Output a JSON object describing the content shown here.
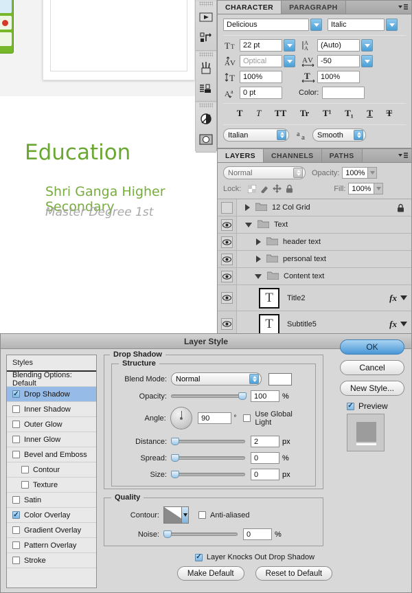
{
  "canvas": {
    "title": "Education",
    "subtitle": "Shri Ganga Higher Secondary",
    "subtitle2": "Master Degree 1st",
    "title_color": "#6aa832",
    "subtitle_color": "#77ac3f",
    "subtitle2_color": "#a8a8a8"
  },
  "icon_dock": {
    "items": [
      {
        "name": "play-icon"
      },
      {
        "name": "actions-icon"
      },
      {
        "name": "brushes-icon"
      },
      {
        "name": "clone-source-icon"
      },
      {
        "name": "adjustments-icon"
      },
      {
        "name": "masks-icon"
      }
    ]
  },
  "character_panel": {
    "tabs": [
      {
        "label": "CHARACTER",
        "active": true
      },
      {
        "label": "PARAGRAPH",
        "active": false
      }
    ],
    "font_family": "Delicious",
    "font_style": "Italic",
    "font_size": "22 pt",
    "leading": "(Auto)",
    "kerning": "Optical",
    "tracking": "-50",
    "vertical_scale": "100%",
    "horizontal_scale": "100%",
    "baseline_shift": "0 pt",
    "color_label": "Color:",
    "color_value": "#ffffff",
    "language": "Italian",
    "anti_alias": "Smooth",
    "text_styles": [
      "T",
      "T",
      "TT",
      "Tr",
      "T¹",
      "T₁",
      "T",
      "T"
    ]
  },
  "layers_panel": {
    "tabs": [
      {
        "label": "LAYERS",
        "active": true
      },
      {
        "label": "CHANNELS",
        "active": false
      },
      {
        "label": "PATHS",
        "active": false
      }
    ],
    "blend_mode": "Normal",
    "opacity_label": "Opacity:",
    "opacity_value": "100%",
    "lock_label": "Lock:",
    "fill_label": "Fill:",
    "fill_value": "100%",
    "layers": [
      {
        "name": "12 Col Grid",
        "visible": false,
        "type": "group",
        "expanded": false,
        "indent": 0,
        "locked": true,
        "fx": false
      },
      {
        "name": "Text",
        "visible": true,
        "type": "group",
        "expanded": true,
        "indent": 0,
        "locked": false,
        "fx": false
      },
      {
        "name": "header text",
        "visible": true,
        "type": "group",
        "expanded": false,
        "indent": 1,
        "locked": false,
        "fx": false
      },
      {
        "name": "personal text",
        "visible": true,
        "type": "group",
        "expanded": false,
        "indent": 1,
        "locked": false,
        "fx": false
      },
      {
        "name": "Content text",
        "visible": true,
        "type": "group",
        "expanded": true,
        "indent": 1,
        "locked": false,
        "fx": false
      },
      {
        "name": "Title2",
        "visible": true,
        "type": "text",
        "indent": 2,
        "locked": false,
        "fx": true
      },
      {
        "name": "Subtitle5",
        "visible": true,
        "type": "text",
        "indent": 2,
        "locked": false,
        "fx": true
      }
    ]
  },
  "layer_style": {
    "title": "Layer Style",
    "styles_header": "Styles",
    "styles": [
      {
        "label": "Blending Options: Default",
        "checkbox": false,
        "checked": false,
        "selected": false,
        "sub": false
      },
      {
        "label": "Drop Shadow",
        "checkbox": true,
        "checked": true,
        "selected": true,
        "sub": false
      },
      {
        "label": "Inner Shadow",
        "checkbox": true,
        "checked": false,
        "selected": false,
        "sub": false
      },
      {
        "label": "Outer Glow",
        "checkbox": true,
        "checked": false,
        "selected": false,
        "sub": false
      },
      {
        "label": "Inner Glow",
        "checkbox": true,
        "checked": false,
        "selected": false,
        "sub": false
      },
      {
        "label": "Bevel and Emboss",
        "checkbox": true,
        "checked": false,
        "selected": false,
        "sub": false
      },
      {
        "label": "Contour",
        "checkbox": true,
        "checked": false,
        "selected": false,
        "sub": true
      },
      {
        "label": "Texture",
        "checkbox": true,
        "checked": false,
        "selected": false,
        "sub": true
      },
      {
        "label": "Satin",
        "checkbox": true,
        "checked": false,
        "selected": false,
        "sub": false
      },
      {
        "label": "Color Overlay",
        "checkbox": true,
        "checked": true,
        "selected": false,
        "sub": false
      },
      {
        "label": "Gradient Overlay",
        "checkbox": true,
        "checked": false,
        "selected": false,
        "sub": false
      },
      {
        "label": "Pattern Overlay",
        "checkbox": true,
        "checked": false,
        "selected": false,
        "sub": false
      },
      {
        "label": "Stroke",
        "checkbox": true,
        "checked": false,
        "selected": false,
        "sub": false
      }
    ],
    "section_title": "Drop Shadow",
    "structure": {
      "legend": "Structure",
      "blend_mode_label": "Blend Mode:",
      "blend_mode_value": "Normal",
      "color_swatch": "#ffffff",
      "opacity_label": "Opacity:",
      "opacity_value": "100",
      "opacity_unit": "%",
      "angle_label": "Angle:",
      "angle_value": "90",
      "angle_unit": "°",
      "use_global_light": "Use Global Light",
      "use_global_light_checked": false,
      "distance_label": "Distance:",
      "distance_value": "2",
      "distance_unit": "px",
      "spread_label": "Spread:",
      "spread_value": "0",
      "spread_unit": "%",
      "size_label": "Size:",
      "size_value": "0",
      "size_unit": "px"
    },
    "quality": {
      "legend": "Quality",
      "contour_label": "Contour:",
      "anti_aliased": "Anti-aliased",
      "anti_aliased_checked": false,
      "noise_label": "Noise:",
      "noise_value": "0",
      "noise_unit": "%"
    },
    "knockout_label": "Layer Knocks Out Drop Shadow",
    "knockout_checked": true,
    "make_default": "Make Default",
    "reset_default": "Reset to Default",
    "buttons": {
      "ok": "OK",
      "cancel": "Cancel",
      "new_style": "New Style...",
      "preview": "Preview",
      "preview_checked": true
    }
  }
}
